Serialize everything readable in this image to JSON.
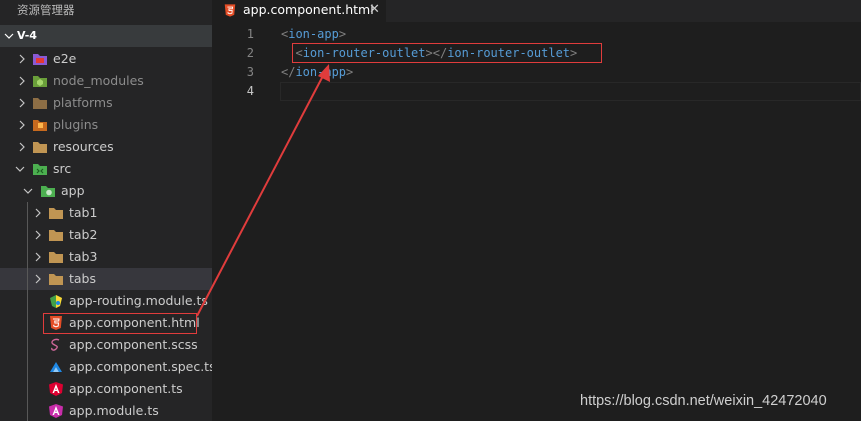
{
  "explorer": {
    "title": "资源管理器",
    "section": "V-4",
    "items": [
      {
        "label": "e2e",
        "icon": "e2e-folder-icon",
        "color": "#8a5ad4"
      },
      {
        "label": "node_modules",
        "icon": "node-folder-icon",
        "color": "#8bc34a"
      },
      {
        "label": "platforms",
        "icon": "folder-icon",
        "color": "#c09553"
      },
      {
        "label": "plugins",
        "icon": "plugins-folder-icon",
        "color": "#ef6c00"
      },
      {
        "label": "resources",
        "icon": "folder-icon",
        "color": "#c09553"
      },
      {
        "label": "src",
        "icon": "src-folder-icon",
        "color": "#4caf50"
      },
      {
        "label": "app",
        "icon": "app-folder-icon",
        "color": "#4caf50"
      },
      {
        "label": "tab1",
        "icon": "folder-icon"
      },
      {
        "label": "tab2",
        "icon": "folder-icon"
      },
      {
        "label": "tab3",
        "icon": "folder-icon"
      },
      {
        "label": "tabs",
        "icon": "folder-icon"
      },
      {
        "label": "app-routing.module.ts",
        "icon": "routing-file-icon"
      },
      {
        "label": "app.component.html",
        "icon": "html5-file-icon",
        "color": "#e44d26"
      },
      {
        "label": "app.component.scss",
        "icon": "sass-file-icon",
        "color": "#cd6799"
      },
      {
        "label": "app.component.spec.ts",
        "icon": "spec-file-icon",
        "color": "#1e88e5"
      },
      {
        "label": "app.component.ts",
        "icon": "angular-file-icon",
        "color": "#dd0031"
      },
      {
        "label": "app.module.ts",
        "icon": "angular-module-file-icon",
        "color": "#c82daa"
      }
    ]
  },
  "editor": {
    "tab_label": "app.component.html",
    "tab_close": "✕",
    "line_numbers": [
      "1",
      "2",
      "3",
      "4"
    ],
    "lines": {
      "l1_open": "<",
      "l1_tag": "ion-app",
      "l1_close": ">",
      "l2_indent": "  ",
      "l2_open1": "<",
      "l2_tag1": "ion-router-outlet",
      "l2_mid": "></",
      "l2_tag2": "ion-router-outlet",
      "l2_close": ">",
      "l3_open": "</",
      "l3_tag": "ion-app",
      "l3_close": ">"
    }
  },
  "watermark": "https://blog.csdn.net/weixin_42472040",
  "colors": {
    "annotation": "#e03c3c",
    "tag": "#569cd6",
    "bracket": "#808080",
    "html5": "#e44d26"
  }
}
